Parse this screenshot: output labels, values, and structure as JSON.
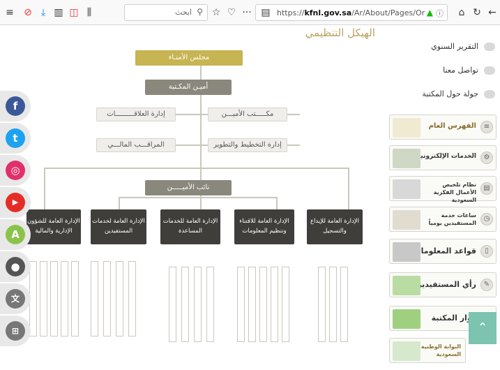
{
  "browser": {
    "search_placeholder": "ابحث",
    "url_prefix": "https://",
    "url_domain": "kfnl.gov.sa",
    "url_path": "/Ar/About/Pages/Or"
  },
  "page": {
    "heading": "الهيكل التنظيمي"
  },
  "org_chart": {
    "council": "مجلس الأمنـاء",
    "secretary": "أميـن المكـتبة",
    "left_top": "إدارة العلاقـــــــــات",
    "right_top": "مكـــــتب الأميـــن",
    "left_mid": "المراقـــب المالـــي",
    "right_mid": "إدارة التخطيط والتطوير",
    "deputy": "نائب الأميـــــن",
    "departments": [
      "الإدارة العامة للشؤون الإدارية والمالية",
      "الإدارة العامة لخدمات المستفيدين",
      "الإدارة العامة للخدمات المساعدة",
      "الإدارة العامة للاقتناء وتنظيم المعلومات",
      "الإدارة العامة للإيداع والتسجيل"
    ]
  },
  "sidebar": {
    "items": [
      {
        "label": "التقرير السنوي"
      },
      {
        "label": "تواصل معنا"
      },
      {
        "label": "جولة حول المكتبة"
      }
    ],
    "cards": [
      {
        "label": "الفهرس العام"
      },
      {
        "label": "الخدمات الإلكترونية"
      },
      {
        "label": "نظام تلخيص الأعمال الفكرية السعودية"
      },
      {
        "label": "ساعات خدمة المستفيدين يومياً"
      },
      {
        "label": "قواعد المعلومات"
      },
      {
        "label": "رأي المستفيدين"
      },
      {
        "label": "زوار المكتبة"
      },
      {
        "label": "البوابة الوطنية السعودية"
      }
    ]
  },
  "social": [
    {
      "name": "facebook",
      "glyph": "f",
      "color": "#3b5998"
    },
    {
      "name": "twitter",
      "glyph": "t",
      "color": "#1da1f2"
    },
    {
      "name": "instagram",
      "glyph": "◎",
      "color": "#e1306c"
    },
    {
      "name": "youtube",
      "glyph": "▶",
      "color": "#e52d27"
    },
    {
      "name": "android",
      "glyph": "A",
      "color": "#8bc34a"
    },
    {
      "name": "apple",
      "glyph": "",
      "color": "#555555"
    },
    {
      "name": "translate",
      "glyph": "文",
      "color": "#666666"
    },
    {
      "name": "sitemap",
      "glyph": "⊞",
      "color": "#666666"
    }
  ]
}
